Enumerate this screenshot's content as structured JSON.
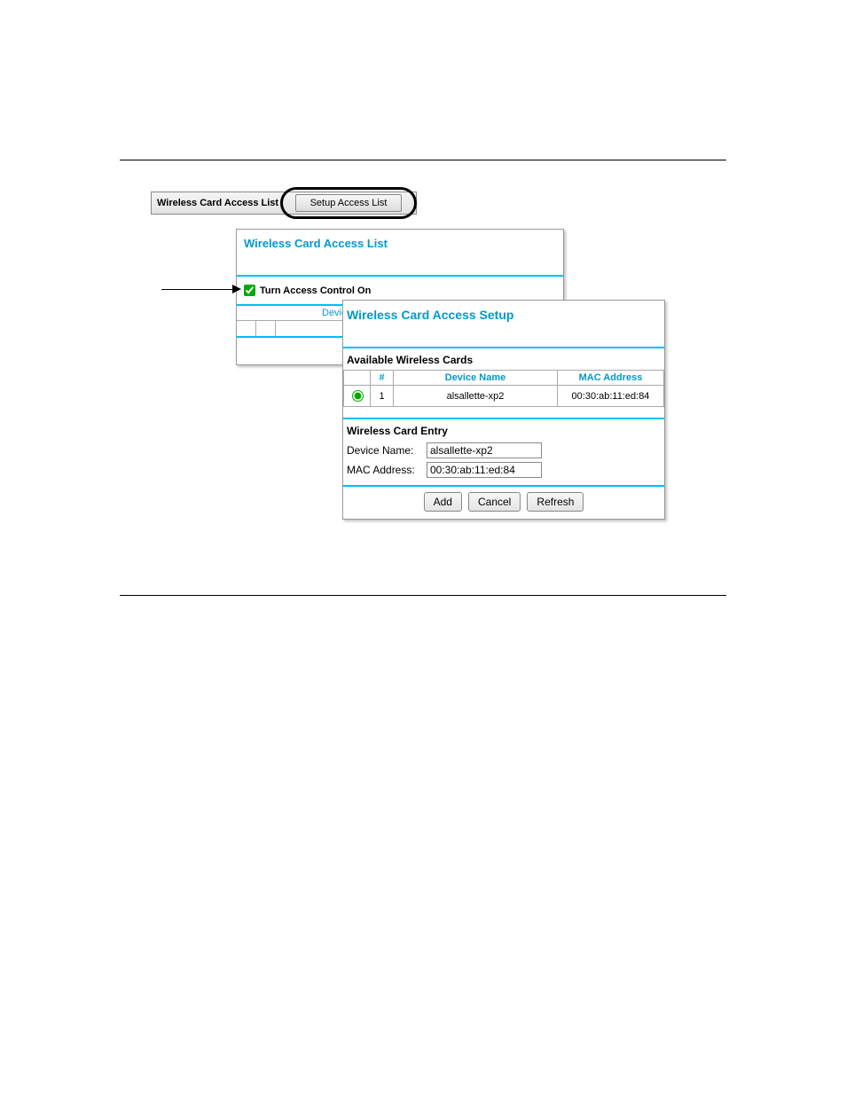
{
  "topbar": {
    "label": "Wireless Card Access List",
    "setup_button": "Setup Access List"
  },
  "panel1": {
    "title": "Wireless Card Access List",
    "checkbox_label": "Turn Access Control On",
    "device_cut": "Device"
  },
  "panel2": {
    "title": "Wireless Card Access Setup",
    "available_header": "Available Wireless Cards",
    "table": {
      "col_num": "#",
      "col_device": "Device Name",
      "col_mac": "MAC Address",
      "rows": [
        {
          "num": "1",
          "device": "alsallette-xp2",
          "mac": "00:30:ab:11:ed:84"
        }
      ]
    },
    "entry_header": "Wireless Card Entry",
    "device_label": "Device Name:",
    "device_value": "alsallette-xp2",
    "mac_label": "MAC Address:",
    "mac_value": "00:30:ab:11:ed:84",
    "buttons": {
      "add": "Add",
      "cancel": "Cancel",
      "refresh": "Refresh"
    }
  }
}
